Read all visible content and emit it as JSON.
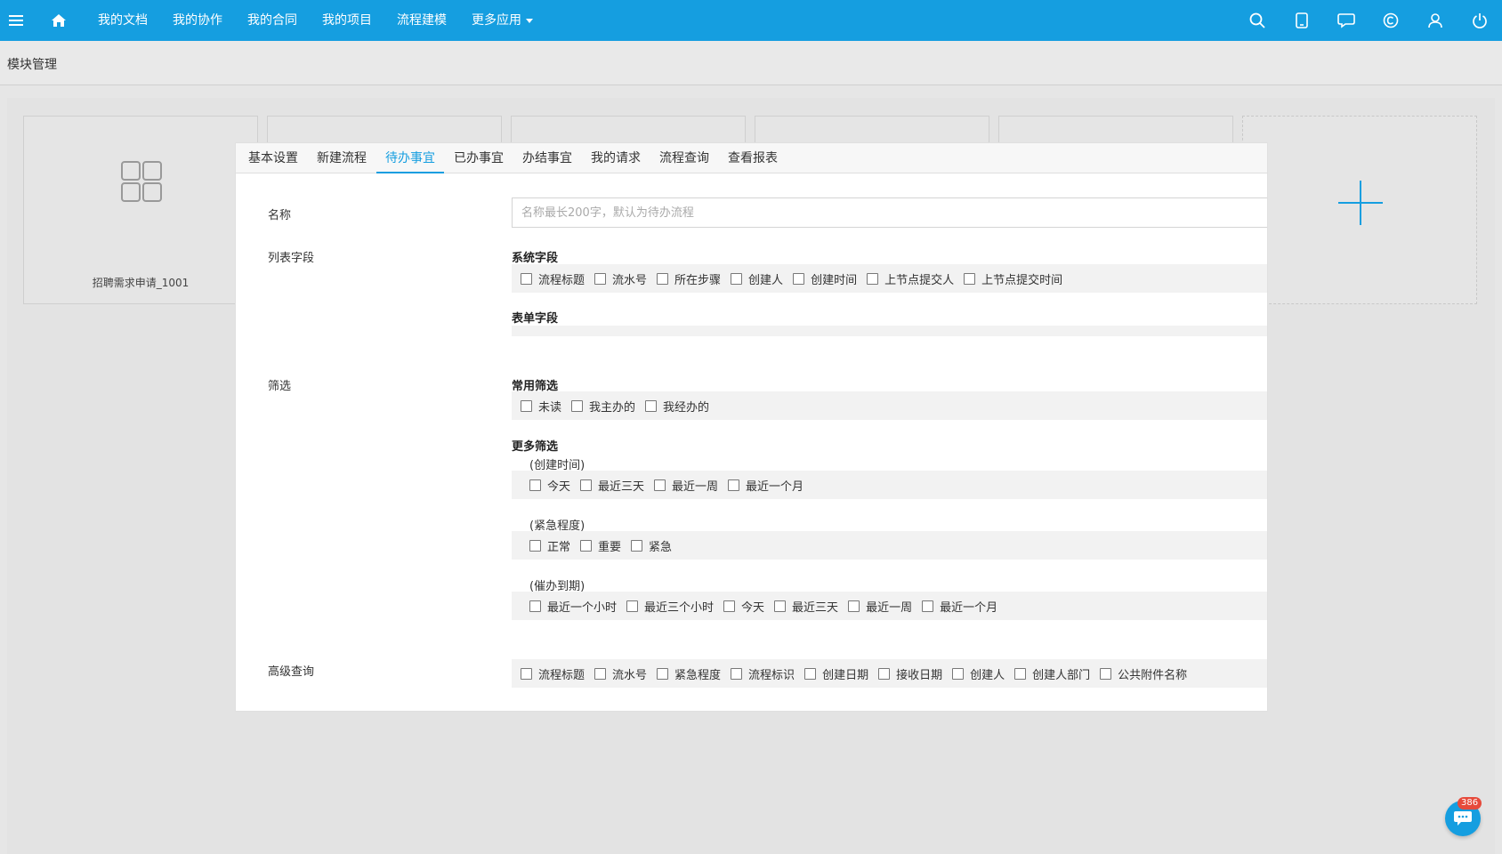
{
  "topnav": {
    "items": [
      "我的文档",
      "我的协作",
      "我的合同",
      "我的项目",
      "流程建模",
      "更多应用"
    ],
    "icons": [
      "search-icon",
      "mobile-icon",
      "chat-icon",
      "copyright-icon",
      "user-icon",
      "power-icon"
    ]
  },
  "breadcrumb": "模块管理",
  "cards": [
    {
      "title": "招聘需求申请_1001"
    }
  ],
  "modal": {
    "tabs": [
      "基本设置",
      "新建流程",
      "待办事宜",
      "已办事宜",
      "办结事宜",
      "我的请求",
      "流程查询",
      "查看报表"
    ],
    "active_tab": "待办事宜",
    "name": {
      "label": "名称",
      "placeholder": "名称最长200字，默认为待办流程"
    },
    "list_fields": {
      "label": "列表字段",
      "system_title": "系统字段",
      "system_options": [
        "流程标题",
        "流水号",
        "所在步骤",
        "创建人",
        "创建时间",
        "上节点提交人",
        "上节点提交时间"
      ],
      "form_title": "表单字段"
    },
    "filter": {
      "label": "筛选",
      "common_title": "常用筛选",
      "common_options": [
        "未读",
        "我主办的",
        "我经办的"
      ],
      "more_title": "更多筛选",
      "created_title": "(创建时间)",
      "created_options": [
        "今天",
        "最近三天",
        "最近一周",
        "最近一个月"
      ],
      "urgency_title": "(紧急程度)",
      "urgency_options": [
        "正常",
        "重要",
        "紧急"
      ],
      "due_title": "(催办到期)",
      "due_options": [
        "最近一个小时",
        "最近三个小时",
        "今天",
        "最近三天",
        "最近一周",
        "最近一个月"
      ]
    },
    "advanced": {
      "label": "高级查询",
      "options": [
        "流程标题",
        "流水号",
        "紧急程度",
        "流程标识",
        "创建日期",
        "接收日期",
        "创建人",
        "创建人部门",
        "公共附件名称"
      ]
    }
  },
  "chat_badge": "386",
  "colors": {
    "primary": "#159ee0",
    "badge": "#e64a3b"
  }
}
